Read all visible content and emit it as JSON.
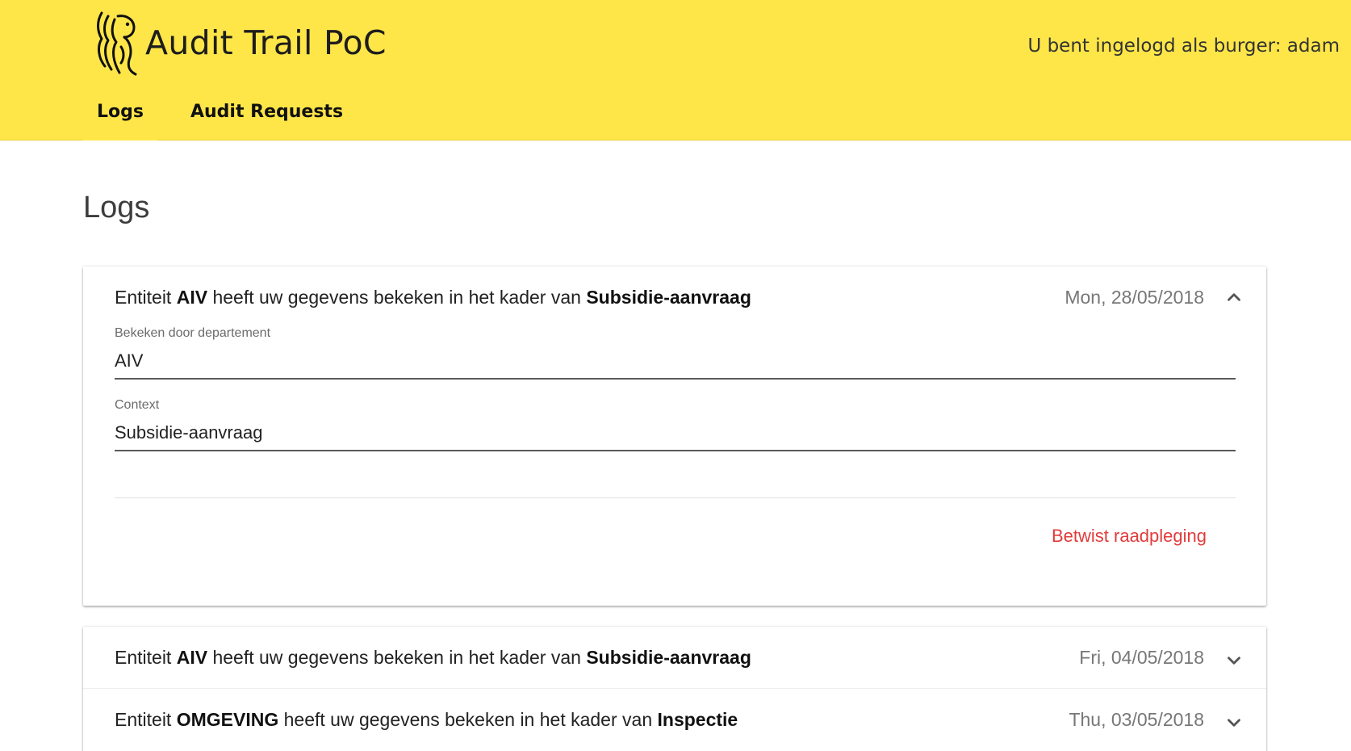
{
  "header": {
    "app_title": "Audit Trail PoC",
    "login_status": "U bent ingelogd als burger: adam",
    "nav": [
      {
        "label": "Logs"
      },
      {
        "label": "Audit Requests"
      }
    ]
  },
  "main": {
    "page_title": "Logs",
    "logs": [
      {
        "prefix": "Entiteit",
        "entity": "AIV",
        "middle": "heeft uw gegevens bekeken in het kader van",
        "context": "Subsidie-aanvraag",
        "date": "Mon, 28/05/2018",
        "expanded": true,
        "details": {
          "department_label": "Bekeken door departement",
          "department_value": "AIV",
          "context_label": "Context",
          "context_value": "Subsidie-aanvraag",
          "dispute_label": "Betwist raadpleging"
        }
      },
      {
        "prefix": "Entiteit",
        "entity": "AIV",
        "middle": "heeft uw gegevens bekeken in het kader van",
        "context": "Subsidie-aanvraag",
        "date": "Fri, 04/05/2018",
        "expanded": false
      },
      {
        "prefix": "Entiteit",
        "entity": "OMGEVING",
        "middle": "heeft uw gegevens bekeken in het kader van",
        "context": "Inspectie",
        "date": "Thu, 03/05/2018",
        "expanded": false
      }
    ]
  },
  "colors": {
    "brand_yellow": "#ffe648",
    "dispute_red": "#e23b3b"
  },
  "icons": {
    "logo": "flemish-lion-logo",
    "expanded": "chevron-up-icon",
    "collapsed": "chevron-down-icon"
  }
}
